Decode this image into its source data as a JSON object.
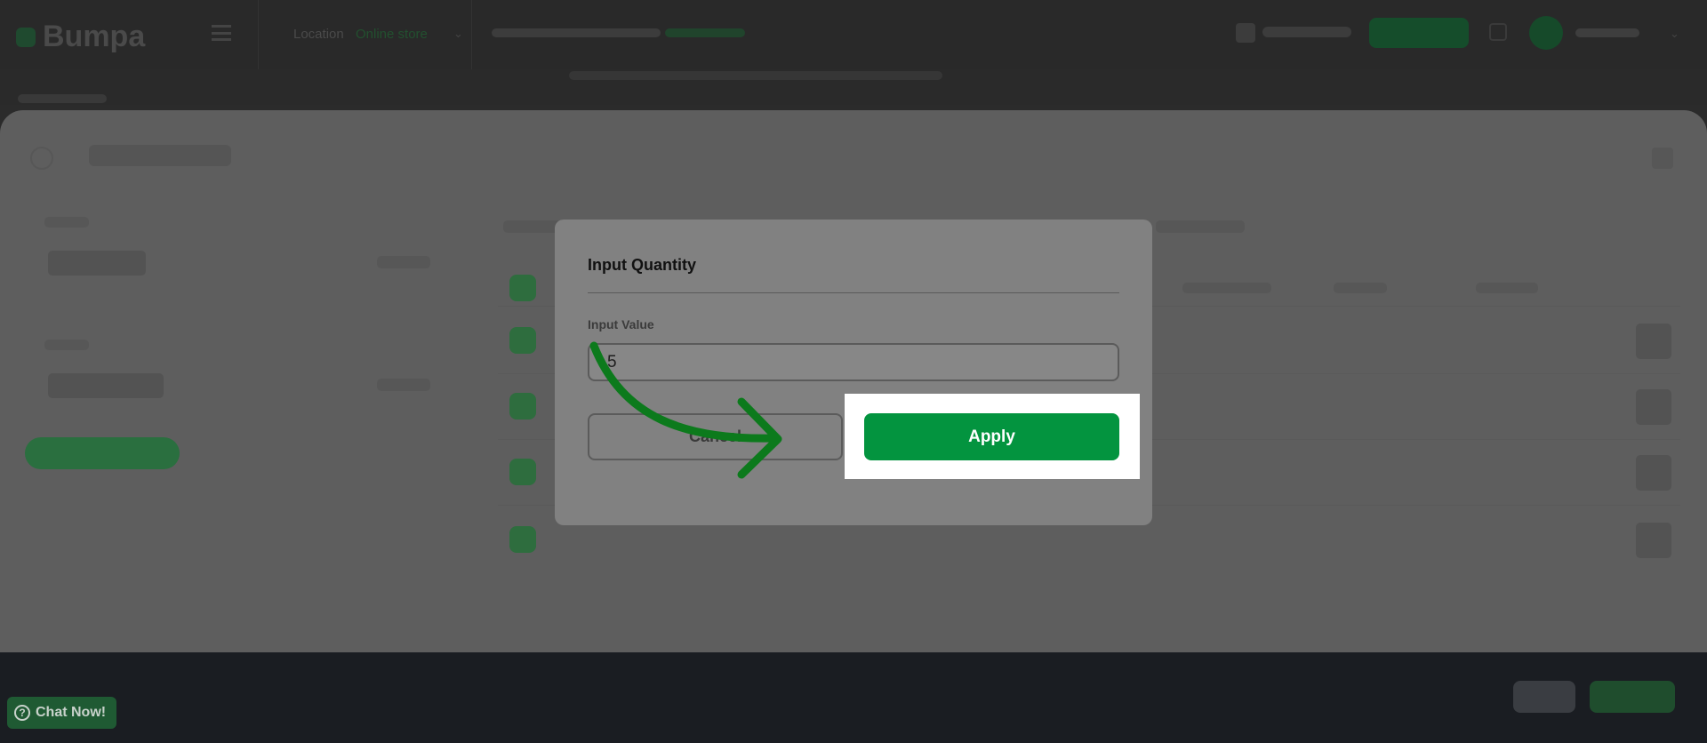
{
  "app": {
    "brand": "Bumpa",
    "location_label": "Location",
    "location_value": "Online store"
  },
  "modal": {
    "title": "Input Quantity",
    "field_label": "Input Value",
    "field_value": "5",
    "cancel_label": "Cancel",
    "apply_label": "Apply"
  },
  "chat": {
    "label": "Chat Now!",
    "icon": "?"
  },
  "colors": {
    "accent": "#03943f",
    "spotlight": "#ffffff",
    "arrow": "#0c7a1c"
  }
}
